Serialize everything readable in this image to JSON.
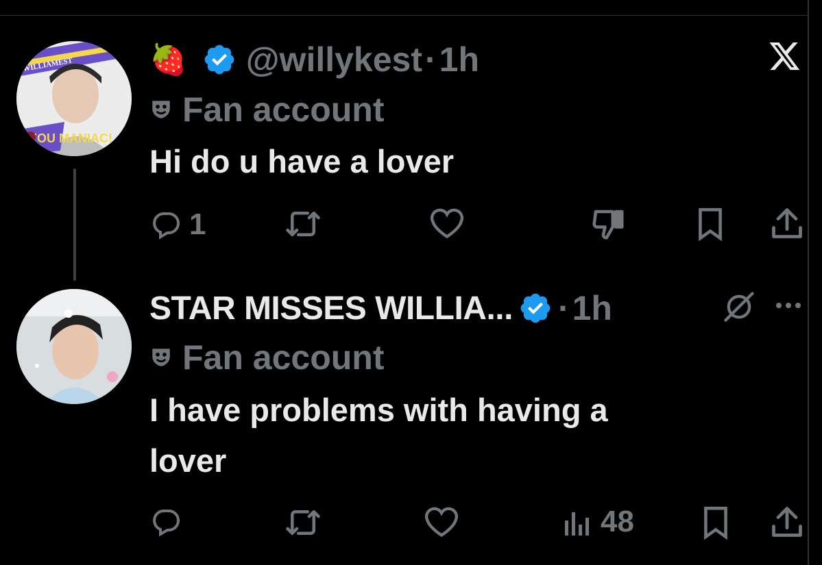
{
  "tweet1": {
    "emoji": "🍓",
    "handle": "@willykest",
    "separator": "·",
    "time": "1h",
    "label": "Fan account",
    "text": "Hi do u have a lover",
    "reply_count": "1",
    "avatar_text_top": "WILLIAMEST",
    "avatar_text_bottom": "YOU MANIAC!"
  },
  "tweet2": {
    "name": "STAR MISSES WILLIA...",
    "separator": "·",
    "time": "1h",
    "label": "Fan account",
    "text_line1": "I have problems with having a",
    "text_line2": "lover",
    "views": "48"
  },
  "colors": {
    "background": "#000000",
    "text": "#e7e9ea",
    "muted": "#71767b",
    "verified": "#1d9bf0"
  },
  "icons": [
    "strawberry-emoji",
    "verified-badge",
    "x-logo",
    "mask-icon",
    "reply-icon",
    "retweet-icon",
    "like-icon",
    "dislike-icon",
    "bookmark-icon",
    "share-icon",
    "grok-icon",
    "more-icon",
    "views-icon"
  ]
}
